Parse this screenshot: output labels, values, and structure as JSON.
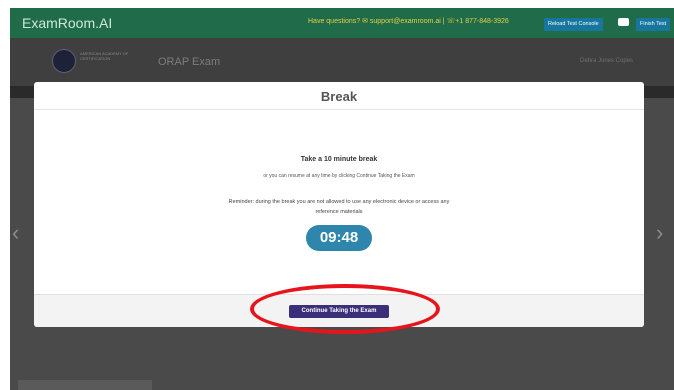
{
  "topbar": {
    "brand": "ExamRoom.AI",
    "questions": "Have questions? ✉ support@examroom.ai | ☏+1 877-848-3926",
    "reload_button": "Reload Test Console",
    "finish_button": "Finish Test"
  },
  "header": {
    "logo_text": "AMERICAN ACADEMY OF CERTIFICATION",
    "exam_title": "ORAP Exam",
    "user_name": "Debra Jones Copes"
  },
  "modal": {
    "title": "Break",
    "heading": "Take a 10 minute break",
    "subtext": "or you can resume at any time by clicking Continue Taking the Exam",
    "reminder_line1": "Reminder: during the break you are not allowed to use any electronic device or access any",
    "reminder_line2": "reference materials",
    "timer": "09:48",
    "continue_button": "Continue Taking the Exam"
  },
  "nav": {
    "left_arrow": "‹",
    "right_arrow": "›"
  },
  "colors": {
    "topbar": "#1f6b4a",
    "timer": "#2f86ad",
    "continue_button": "#3a2f78",
    "highlight": "#e8141b"
  }
}
